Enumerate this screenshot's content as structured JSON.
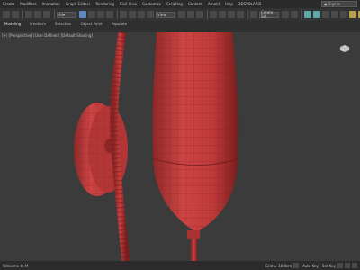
{
  "menu": {
    "items": [
      "Create",
      "Modifiers",
      "Animation",
      "Graph Editors",
      "Rendering",
      "Civil View",
      "Customize",
      "Scripting",
      "Content",
      "Arnold",
      "Help",
      "3DSPOLARIS"
    ],
    "search_placeholder": "Sign in"
  },
  "toolbar": {
    "view_dropdown": "View",
    "set_dropdown": "Create Sel..."
  },
  "ribbon": {
    "tabs": [
      "Modeling",
      "Freeform",
      "Selection",
      "Object Paint",
      "Populate"
    ]
  },
  "viewport": {
    "label": "[+] [Perspective] [User Defined] [Default Shading]"
  },
  "status": {
    "text": "Welcome to M",
    "auto_key": "Auto Key",
    "set_key": "Set Key",
    "grid": "Grid = 10.0cm"
  },
  "colors": {
    "mesh": "#c33a3a",
    "mesh_dark": "#7d1e1e",
    "background": "#3b3b3b"
  }
}
